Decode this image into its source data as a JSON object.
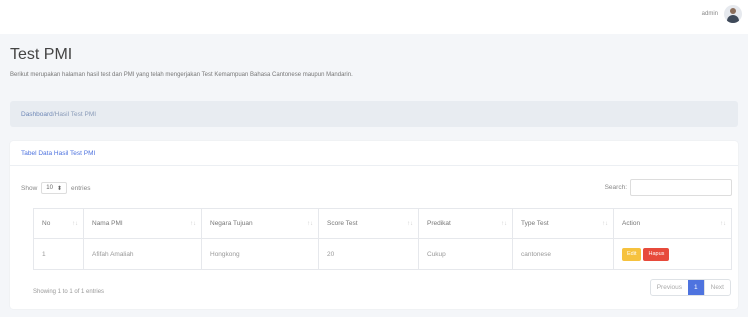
{
  "topbar": {
    "user_name": "admin"
  },
  "page": {
    "title": "Test PMI",
    "description": "Berikut merupakan halaman hasil test dan PMI yang telah mengerjakan Test Kemampuan Bahasa Cantonese maupun Mandarin."
  },
  "breadcrumb": {
    "link": "Dashboard",
    "current": "/Hasil Test PMI"
  },
  "card": {
    "title": "Tabel Data Hasil Test PMI"
  },
  "controls": {
    "show_label": "Show",
    "page_size": "10",
    "entries_label": "entries",
    "search_label": "Search:"
  },
  "table": {
    "headers": [
      "No",
      "Nama PMI",
      "Negara Tujuan",
      "Score Test",
      "Predikat",
      "Type Test",
      "Action"
    ],
    "rows": [
      {
        "no": "1",
        "nama": "Afifah Amaliah",
        "negara": "Hongkong",
        "score": "20",
        "predikat": "Cukup",
        "type": "cantonese"
      }
    ],
    "edit_label": "Edit",
    "delete_label": "Hapus"
  },
  "footer": {
    "info": "Showing 1 to 1 of 1 entries",
    "previous": "Previous",
    "page": "1",
    "next": "Next"
  },
  "colors": {
    "primary": "#4e73df",
    "warning": "#f6c23e",
    "danger": "#e74a3b"
  }
}
